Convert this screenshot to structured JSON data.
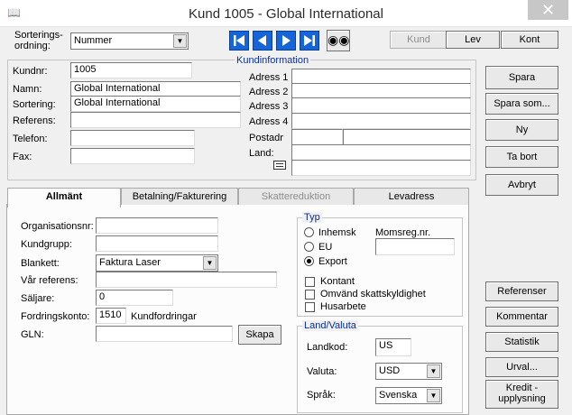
{
  "window": {
    "title": "Kund 1005 - Global International",
    "close_glyph": "✕"
  },
  "toolbar": {
    "sort_label_1": "Sorterings-",
    "sort_label_2": "ordning:",
    "sort_value": "Nummer",
    "kund": "Kund",
    "lev": "Lev",
    "kont": "Kont"
  },
  "kundinfo_title": "Kundinformation",
  "fields": {
    "kundnr_label": "Kundnr:",
    "kundnr": "1005",
    "namn_label": "Namn:",
    "namn": "Global International",
    "sortering_label": "Sortering:",
    "sortering": "Global International",
    "referens_label": "Referens:",
    "referens": "",
    "telefon_label": "Telefon:",
    "telefon": "",
    "fax_label": "Fax:",
    "fax": ""
  },
  "address": {
    "adress1": "Adress 1",
    "adress2": "Adress 2",
    "adress3": "Adress 3",
    "adress4": "Adress 4",
    "postadr": "Postadr",
    "land": "Land:"
  },
  "side_buttons": {
    "spara": "Spara",
    "spara_som": "Spara som...",
    "ny": "Ny",
    "ta_bort": "Ta bort",
    "avbryt": "Avbryt",
    "referenser": "Referenser",
    "kommentar": "Kommentar",
    "statistik": "Statistik",
    "urval": "Urval...",
    "kredit_1": "Kredit -",
    "kredit_2": "upplysning"
  },
  "tabs": [
    "Allmänt",
    "Betalning/Fakturering",
    "Skattereduktion",
    "Levadress"
  ],
  "general": {
    "orgnr_label": "Organisationsnr:",
    "kundgrupp_label": "Kundgrupp:",
    "blankett_label": "Blankett:",
    "blankett": "Faktura Laser",
    "var_ref_label": "Vår referens:",
    "saljare_label": "Säljare:",
    "saljare": "0",
    "fordring_label": "Fordringskonto:",
    "fordring": "1510",
    "fordring_name": "Kundfordringar",
    "gln_label": "GLN:",
    "skapa": "Skapa"
  },
  "typ": {
    "title": "Typ",
    "inhemsk": "Inhemsk",
    "eu": "EU",
    "export": "Export",
    "momsreg": "Momsreg.nr.",
    "kontant": "Kontant",
    "omvand": "Omvänd skattskyldighet",
    "husarbete": "Husarbete"
  },
  "landvaluta": {
    "title": "Land/Valuta",
    "landkod_label": "Landkod:",
    "landkod": "US",
    "valuta_label": "Valuta:",
    "valuta": "USD",
    "sprak_label": "Språk:",
    "sprak": "Svenska"
  }
}
